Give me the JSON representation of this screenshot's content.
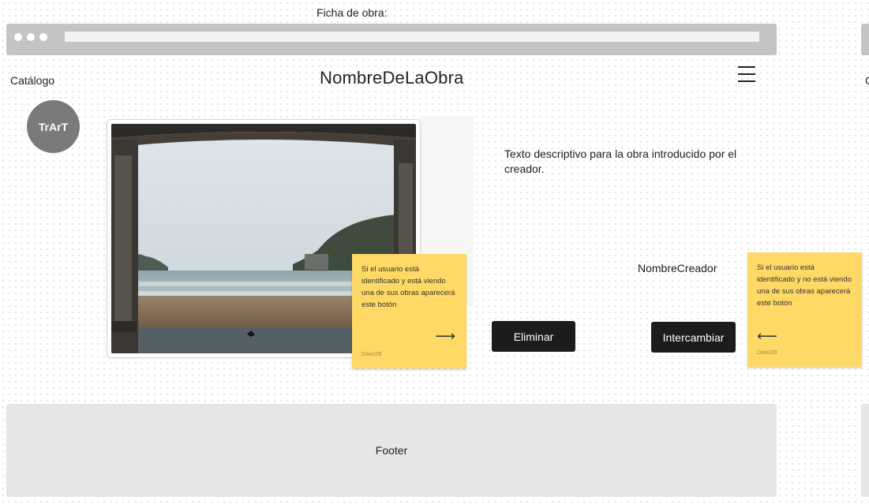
{
  "frame": {
    "title": "Ficha de obra:"
  },
  "header": {
    "catalog_link": "Catálogo",
    "artwork_title": "NombreDeLaObra",
    "logo_text": "TrArT"
  },
  "artwork": {
    "description": "Texto descriptivo para la obra introducido por el creador.",
    "creator_name": "NombreCreador"
  },
  "actions": {
    "delete_label": "Eliminar",
    "swap_label": "Intercambiar"
  },
  "notes": [
    {
      "text": "Si el usuario está identificado y está viendo una de sus obras aparecerá este botón",
      "author": "Daw109",
      "arrow": "⟶"
    },
    {
      "text": "Si el usuario está identificado y no está viendo una de sus obras aparecerá este botón",
      "author": "Daw109",
      "arrow": "⟵"
    }
  ],
  "footer": {
    "label": "Footer"
  },
  "colors": {
    "sticky": "#ffd966",
    "button": "#1c1c1c",
    "logo": "#7a7a7a",
    "footer": "#e6e6e6"
  }
}
